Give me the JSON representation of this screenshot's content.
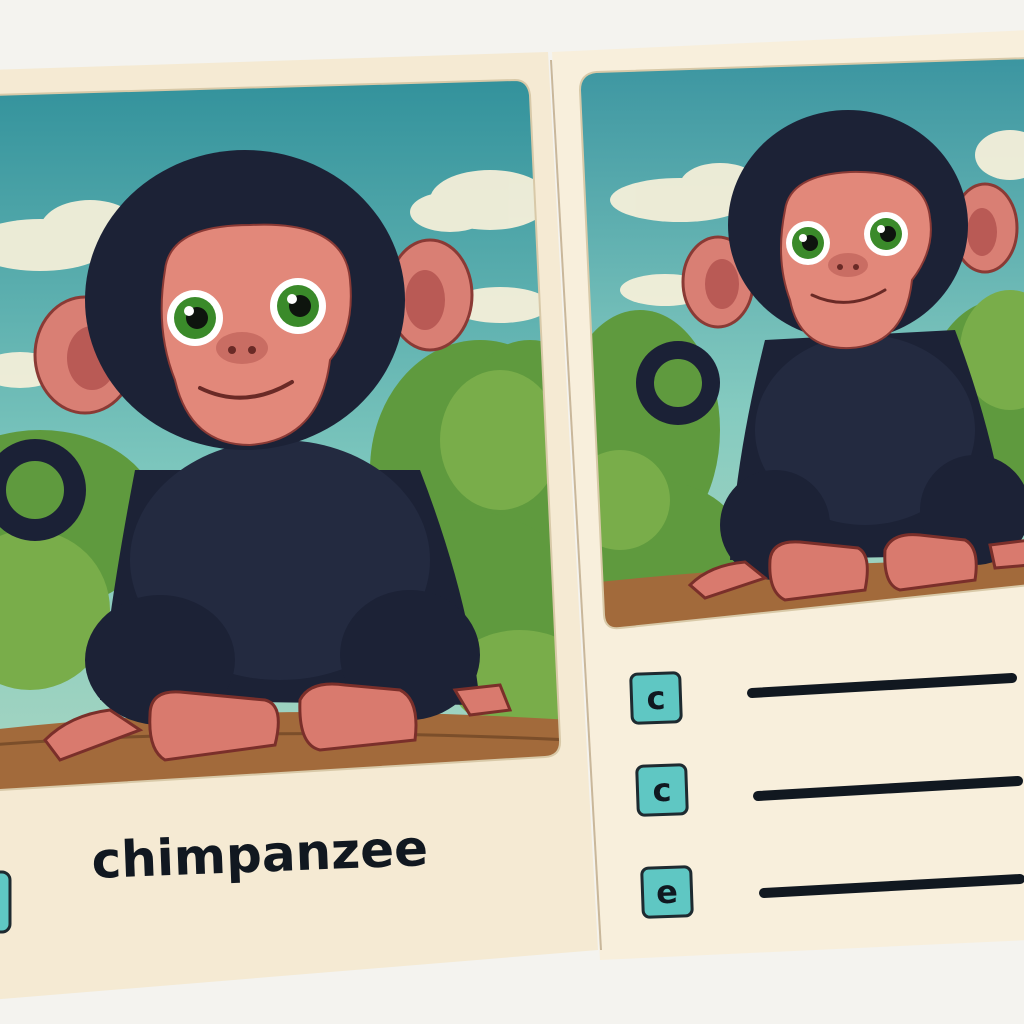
{
  "word_card": {
    "word": "chimpanzee"
  },
  "worksheet": {
    "letter_boxes": [
      "c",
      "c",
      "e"
    ],
    "answer_lines": 3
  },
  "illustration": {
    "subject": "chimpanzee-icon",
    "colors": {
      "fur": "#1c2236",
      "face": "#e0877a",
      "eye_iris": "#3a8a2a",
      "sky": "#66b8b4",
      "foliage": "#5a8a30",
      "ground": "#9a6a3a",
      "card": "#f6ecd6",
      "letter_box": "#5fc7c3"
    }
  }
}
